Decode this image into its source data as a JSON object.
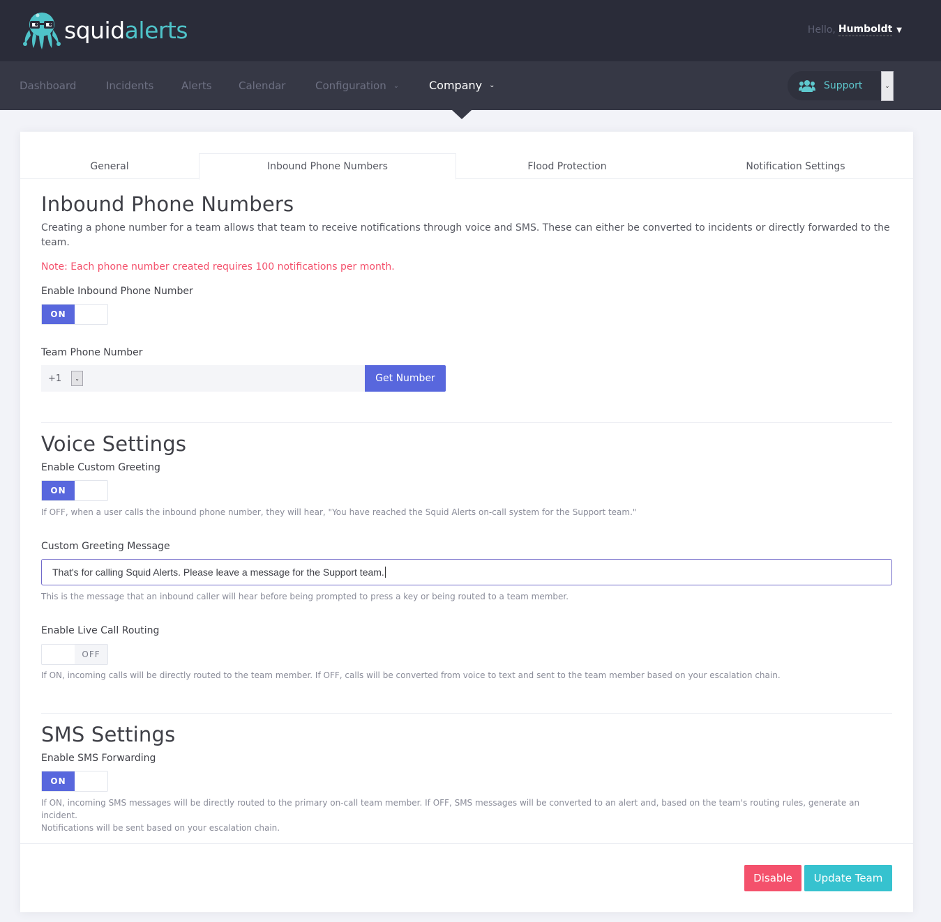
{
  "brand": {
    "name_part1": "squid",
    "name_part2": "alerts",
    "logo_icon": "squid-mascot-icon",
    "primary_color": "#2a2c39",
    "accent_color": "#4fc3c9"
  },
  "user": {
    "greeting": "Hello,",
    "name": "Humboldt"
  },
  "nav": {
    "items": [
      {
        "label": "Dashboard"
      },
      {
        "label": "Incidents"
      },
      {
        "label": "Alerts"
      },
      {
        "label": "Calendar"
      },
      {
        "label": "Configuration"
      },
      {
        "label": "Company"
      }
    ],
    "active": "Company",
    "team_selector": "Support",
    "team_icon": "users-icon"
  },
  "tabs": [
    {
      "label": "General"
    },
    {
      "label": "Inbound Phone Numbers"
    },
    {
      "label": "Flood Protection"
    },
    {
      "label": "Notification Settings"
    }
  ],
  "inbound": {
    "title": "Inbound Phone Numbers",
    "description": "Creating a phone number for a team allows that team to receive notifications through voice and SMS. These can either be converted to incidents or directly forwarded to the team.",
    "note": "Note: Each phone number created requires 100 notifications per month.",
    "enable_label": "Enable Inbound Phone Number",
    "enable_state": "ON",
    "phone_label": "Team Phone Number",
    "country_code": "+1",
    "phone_value": "",
    "get_number_label": "Get Number"
  },
  "voice": {
    "title": "Voice Settings",
    "greeting_label": "Enable Custom Greeting",
    "greeting_state": "ON",
    "greeting_help": "If OFF, when a user calls the inbound phone number, they will hear, \"You have reached the Squid Alerts on-call system for the Support team.\"",
    "message_label": "Custom Greeting Message",
    "message_value": "That's for calling Squid Alerts. Please leave a message for the Support team.",
    "message_help": "This is the message that an inbound caller will hear before being prompted to press a key or being routed to a team member.",
    "routing_label": "Enable Live Call Routing",
    "routing_state": "OFF",
    "routing_help": "If ON, incoming calls will be directly routed to the team member. If OFF, calls will be converted from voice to text and sent to the team member based on your escalation chain."
  },
  "sms": {
    "title": "SMS Settings",
    "forwarding_label": "Enable SMS Forwarding",
    "forwarding_state": "ON",
    "forwarding_help_line1": "If ON, incoming SMS messages will be directly routed to the primary on-call team member. If OFF, SMS messages will be converted to an alert and, based on the team's routing rules, generate an incident.",
    "forwarding_help_line2": "Notifications will be sent based on your escalation chain."
  },
  "actions": {
    "disable_label": "Disable",
    "update_label": "Update Team",
    "disable_color": "#f4516c",
    "update_color": "#36c2cf"
  }
}
